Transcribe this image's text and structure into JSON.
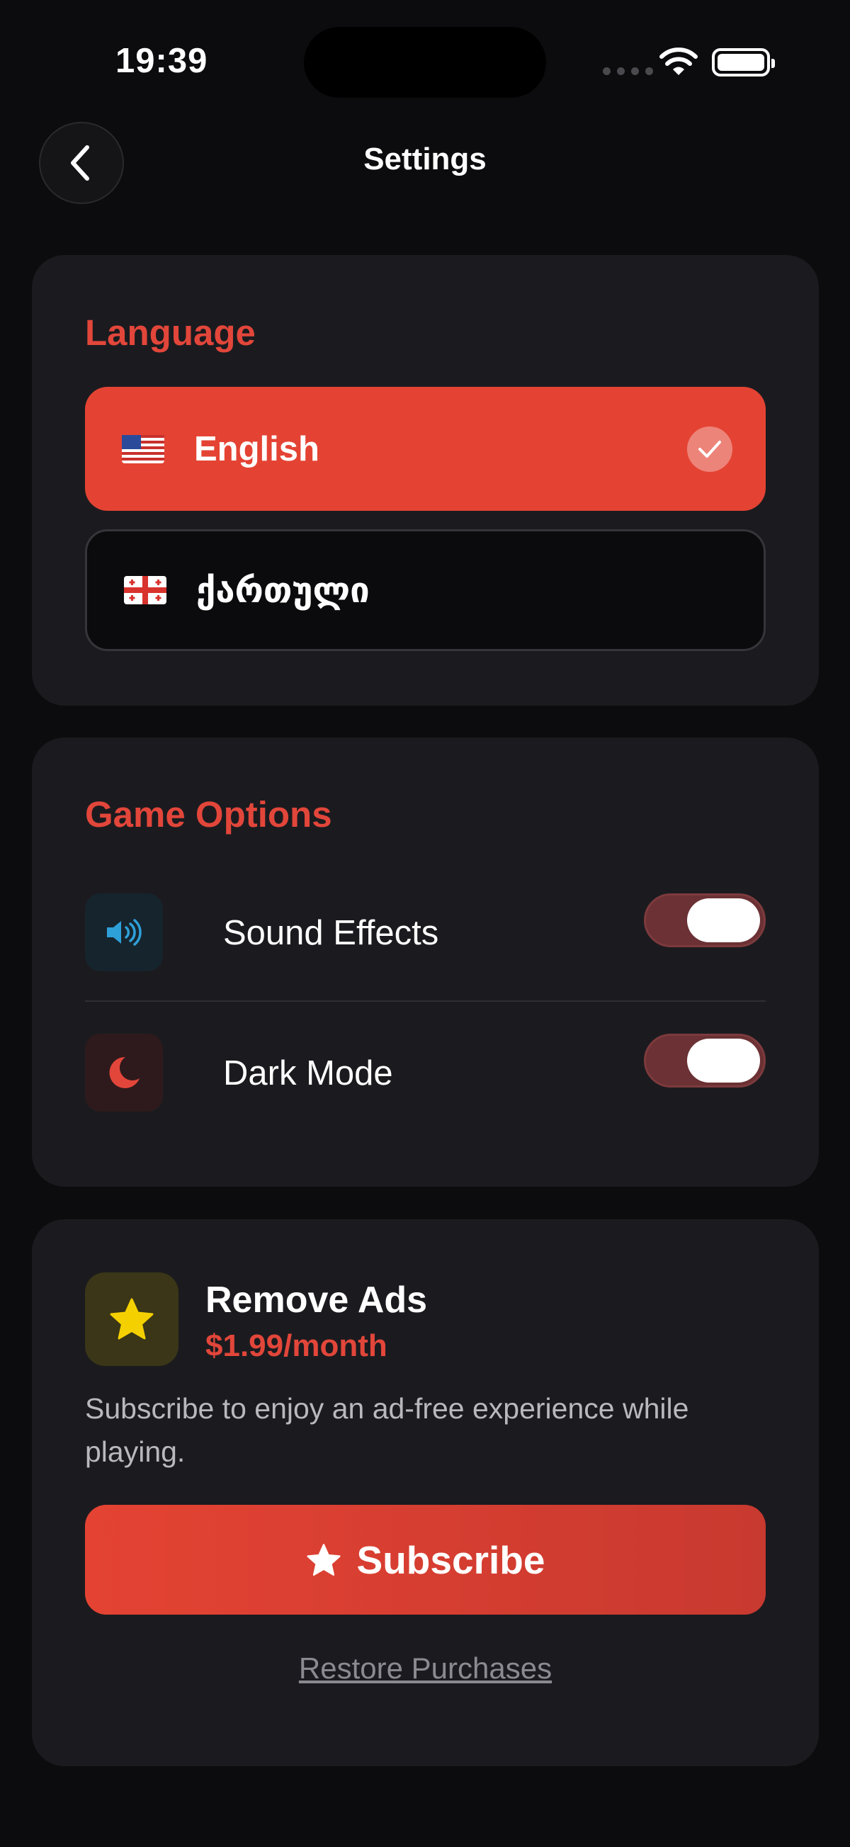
{
  "status_bar": {
    "time": "19:39"
  },
  "header": {
    "title": "Settings",
    "back_icon": "chevron-left-icon"
  },
  "language": {
    "title": "Language",
    "options": [
      {
        "label": "English",
        "flag": "us-flag-icon",
        "selected": true
      },
      {
        "label": "ქართული",
        "flag": "georgia-flag-icon",
        "selected": false
      }
    ]
  },
  "game_options": {
    "title": "Game Options",
    "items": [
      {
        "label": "Sound Effects",
        "icon": "speaker-icon",
        "enabled": true
      },
      {
        "label": "Dark Mode",
        "icon": "moon-icon",
        "enabled": true
      }
    ]
  },
  "remove_ads": {
    "title": "Remove Ads",
    "price": "$1.99/month",
    "description": "Subscribe to enjoy an ad-free experience while playing.",
    "subscribe_label": "Subscribe",
    "restore_label": "Restore Purchases"
  },
  "colors": {
    "accent": "#e44333",
    "background": "#0c0c0e",
    "card": "#1b1b1f",
    "toggle_on": "#6b3134",
    "speaker_blue": "#2ea0d8",
    "star_yellow": "#f5d000"
  }
}
